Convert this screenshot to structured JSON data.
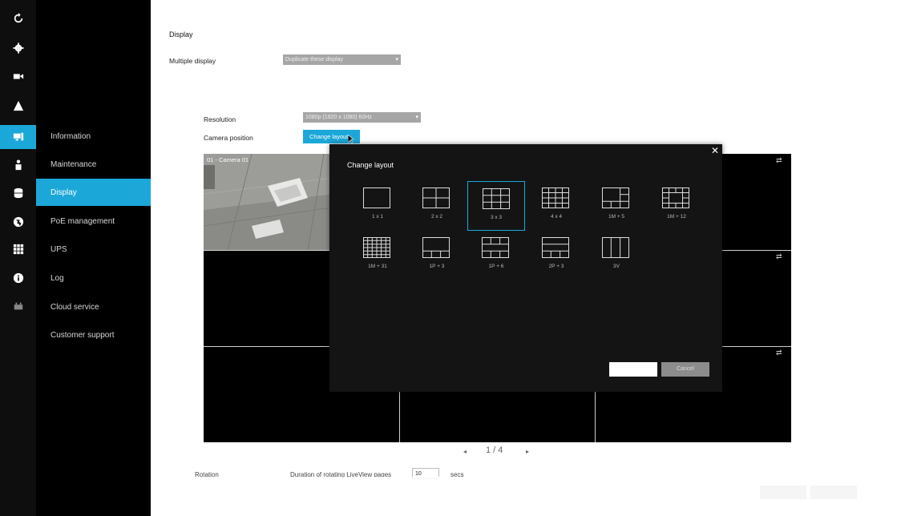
{
  "rail": {
    "icons": [
      "refresh-icon",
      "gear-icon",
      "video-camera-icon",
      "alert-triangle-icon",
      "monitor-icon",
      "user-icon",
      "database-icon",
      "network-icon",
      "apps-grid-icon",
      "info-icon",
      "device-icon"
    ],
    "active_index": 4
  },
  "menu": {
    "items": [
      "Information",
      "Maintenance",
      "Display",
      "PoE management",
      "UPS",
      "Log",
      "Cloud service",
      "Customer support"
    ],
    "active_index": 2
  },
  "display": {
    "title": "Display",
    "multiple_display_label": "Multiple display",
    "multiple_display_value": "Duplicate these display",
    "resolution_label": "Resolution",
    "resolution_value": "1080p (1920 x 1080) 60Hz",
    "camera_position_label": "Camera position",
    "change_layout_button": "Change layout"
  },
  "preview": {
    "camera_label": "01 - Camera 01",
    "pager": "1 / 4"
  },
  "rotation": {
    "label": "Rotation",
    "duration_label": "Duration of rotating LiveView pages",
    "duration_value": "10",
    "unit": "secs"
  },
  "modal": {
    "title": "Change layout",
    "options": [
      "1 x 1",
      "2 x 2",
      "3 x 3",
      "4 x 4",
      "1M + 5",
      "1M + 12",
      "1M + 31",
      "1P + 3",
      "1P + 6",
      "2P + 3",
      "3V"
    ],
    "selected": "3 x 3",
    "cancel_label": "Cancel"
  },
  "colors": {
    "accent": "#1ba8d8",
    "rail_bg": "#0e0e0e",
    "menu_bg": "#000000",
    "modal_bg": "#141414"
  }
}
